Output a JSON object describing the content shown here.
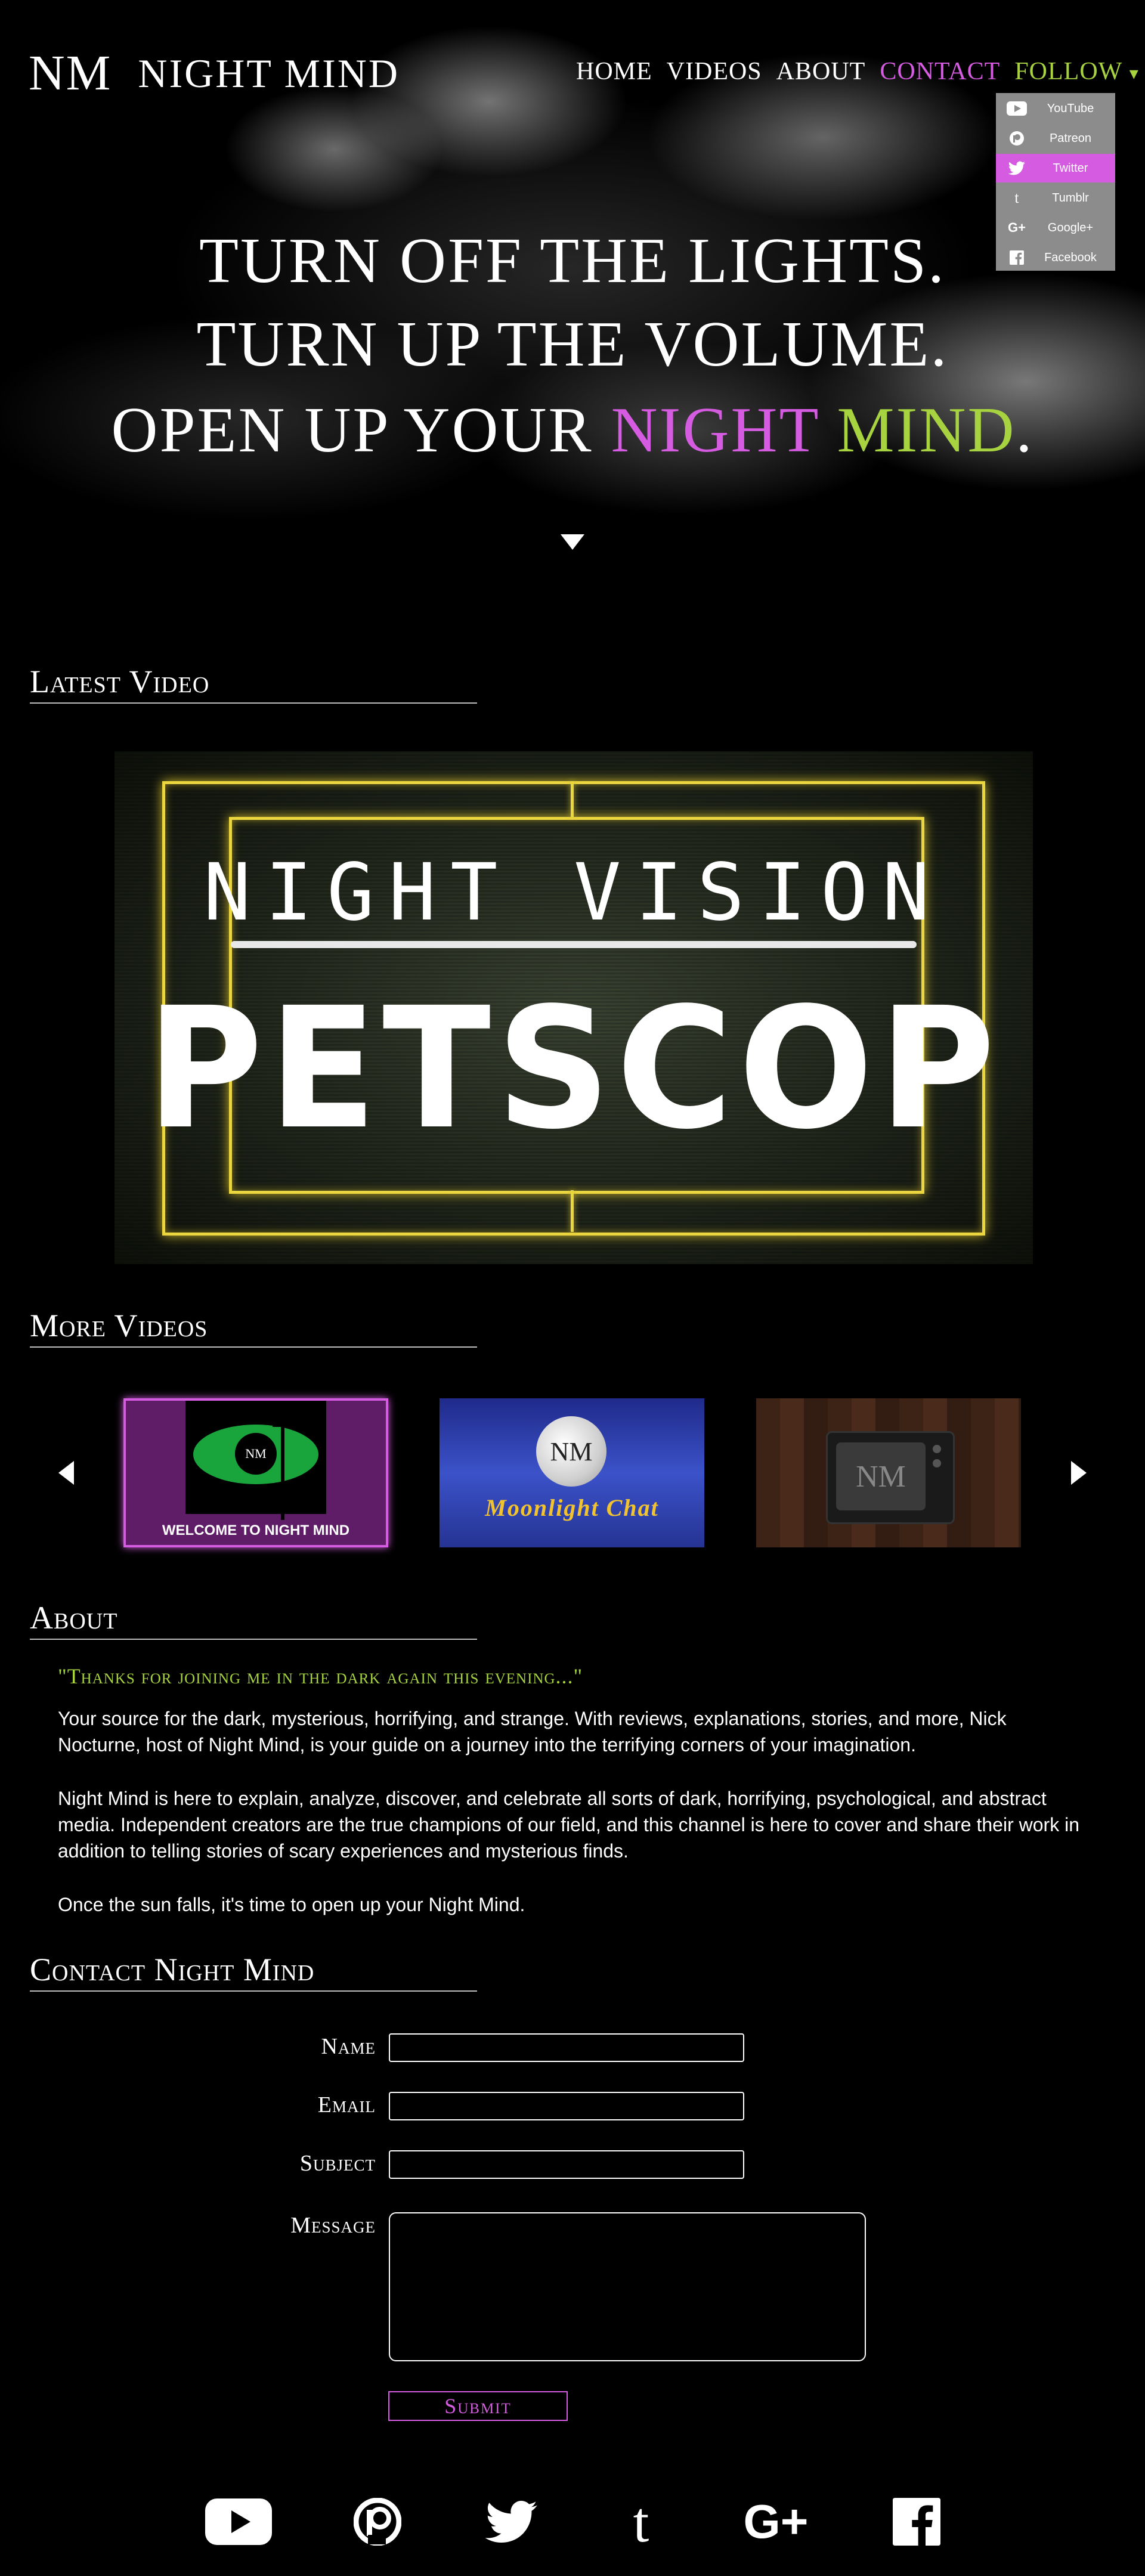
{
  "brand": {
    "mark": "NM",
    "name": "NIGHT MIND"
  },
  "nav": {
    "items": [
      "HOME",
      "VIDEOS",
      "ABOUT",
      "CONTACT",
      "FOLLOW"
    ],
    "follow_caret": "▾"
  },
  "follow_menu": {
    "items": [
      {
        "label": "YouTube",
        "icon": "youtube-icon"
      },
      {
        "label": "Patreon",
        "icon": "patreon-icon"
      },
      {
        "label": "Twitter",
        "icon": "twitter-icon",
        "active": true
      },
      {
        "label": "Tumblr",
        "icon": "tumblr-icon"
      },
      {
        "label": "Google+",
        "icon": "google-plus-icon"
      },
      {
        "label": "Facebook",
        "icon": "facebook-icon"
      }
    ]
  },
  "hero": {
    "line1": "TURN OFF THE LIGHTS.",
    "line2": "TURN UP THE VOLUME.",
    "line3_prefix": "OPEN UP YOUR ",
    "line3_night": "NIGHT",
    "line3_mind": "MIND",
    "line3_suffix": "."
  },
  "latest_video": {
    "heading": "Latest Video",
    "thumb_line1": "NIGHT VISION",
    "thumb_line2": "PETSCOP"
  },
  "more_videos": {
    "heading": "More Videos",
    "thumbs": [
      {
        "mark": "NM",
        "caption": "WELCOME TO NIGHT MIND"
      },
      {
        "mark": "NM",
        "caption": "Moonlight Chat"
      },
      {
        "mark": "NM"
      }
    ]
  },
  "about": {
    "heading": "About",
    "quote": "\"Thanks for joining me in the dark again this evening...\"",
    "p1": "Your source for the dark, mysterious, horrifying, and strange. With reviews, explanations, stories, and more, Nick Nocturne, host of Night Mind, is your guide on a journey into the terrifying corners of your imagination.",
    "p2": "Night Mind is here to explain, analyze, discover, and celebrate all sorts of dark, horrifying, psychological, and abstract media. Independent creators are the true champions of our field, and this channel is here to cover and share their work in addition to telling stories of scary experiences and mysterious finds.",
    "p3": "Once the sun falls, it's time to open up your Night Mind."
  },
  "contact": {
    "heading": "Contact Night Mind",
    "name_label": "Name",
    "email_label": "Email",
    "subject_label": "Subject",
    "message_label": "Message",
    "name_value": "",
    "email_value": "",
    "subject_value": "",
    "message_value": "",
    "submit_label": "Submit"
  },
  "footer": {
    "icons": [
      "youtube-icon",
      "patreon-icon",
      "twitter-icon",
      "tumblr-icon",
      "google-plus-icon",
      "facebook-icon"
    ],
    "gplus_text": "G+",
    "tumblr_text": "t",
    "facebook_text": "f"
  },
  "colors": {
    "accent_purple": "#d55ce0",
    "accent_green": "#a6d33f",
    "background": "#000000",
    "dropdown_bg": "#8c8c8c",
    "video_frame": "#ecd640"
  }
}
